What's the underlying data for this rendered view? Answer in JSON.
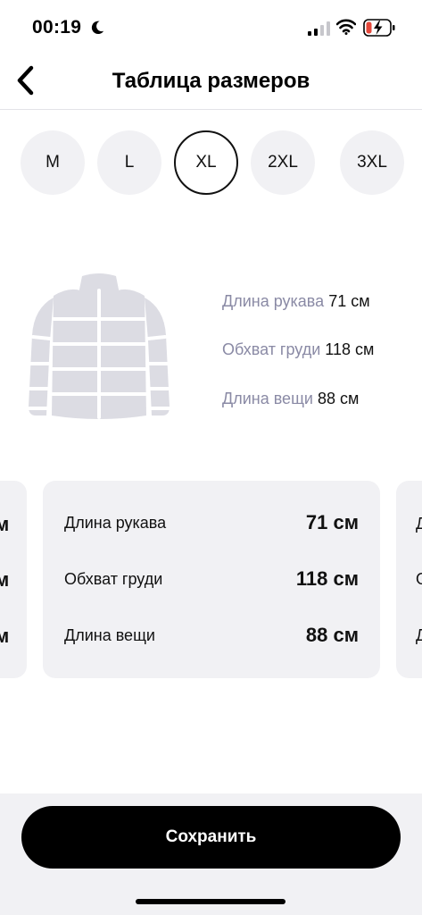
{
  "status_bar": {
    "time": "00:19",
    "icons": [
      "moon-icon",
      "cellular-signal-icon",
      "wifi-icon",
      "battery-charging-icon"
    ],
    "battery_color": "#e5483b"
  },
  "header": {
    "back_icon": "chevron-left-icon",
    "title": "Таблица размеров"
  },
  "sizes": {
    "options": [
      "M",
      "L",
      "XL",
      "2XL",
      "3XL"
    ],
    "selected": "XL"
  },
  "product_info": {
    "illustration": "puffer-jacket-icon",
    "lines": [
      {
        "label": "Длина рукава",
        "value": "71 см"
      },
      {
        "label": "Обхват груди",
        "value": "118 см"
      },
      {
        "label": "Длина вещи",
        "value": "88 см"
      }
    ]
  },
  "measurement_card": {
    "rows": [
      {
        "label": "Длина рукава",
        "value": "71 см"
      },
      {
        "label": "Обхват груди",
        "value": "118 см"
      },
      {
        "label": "Длина вещи",
        "value": "88 см"
      }
    ],
    "prev_card_fragments": [
      "м",
      "м",
      "м"
    ],
    "next_card_fragments": [
      "Д",
      "О",
      "Д"
    ]
  },
  "footer": {
    "save_label": "Сохранить"
  },
  "colors": {
    "chip_background": "#f1f1f4",
    "label_muted": "#8a8aa5",
    "primary": "#000000"
  }
}
